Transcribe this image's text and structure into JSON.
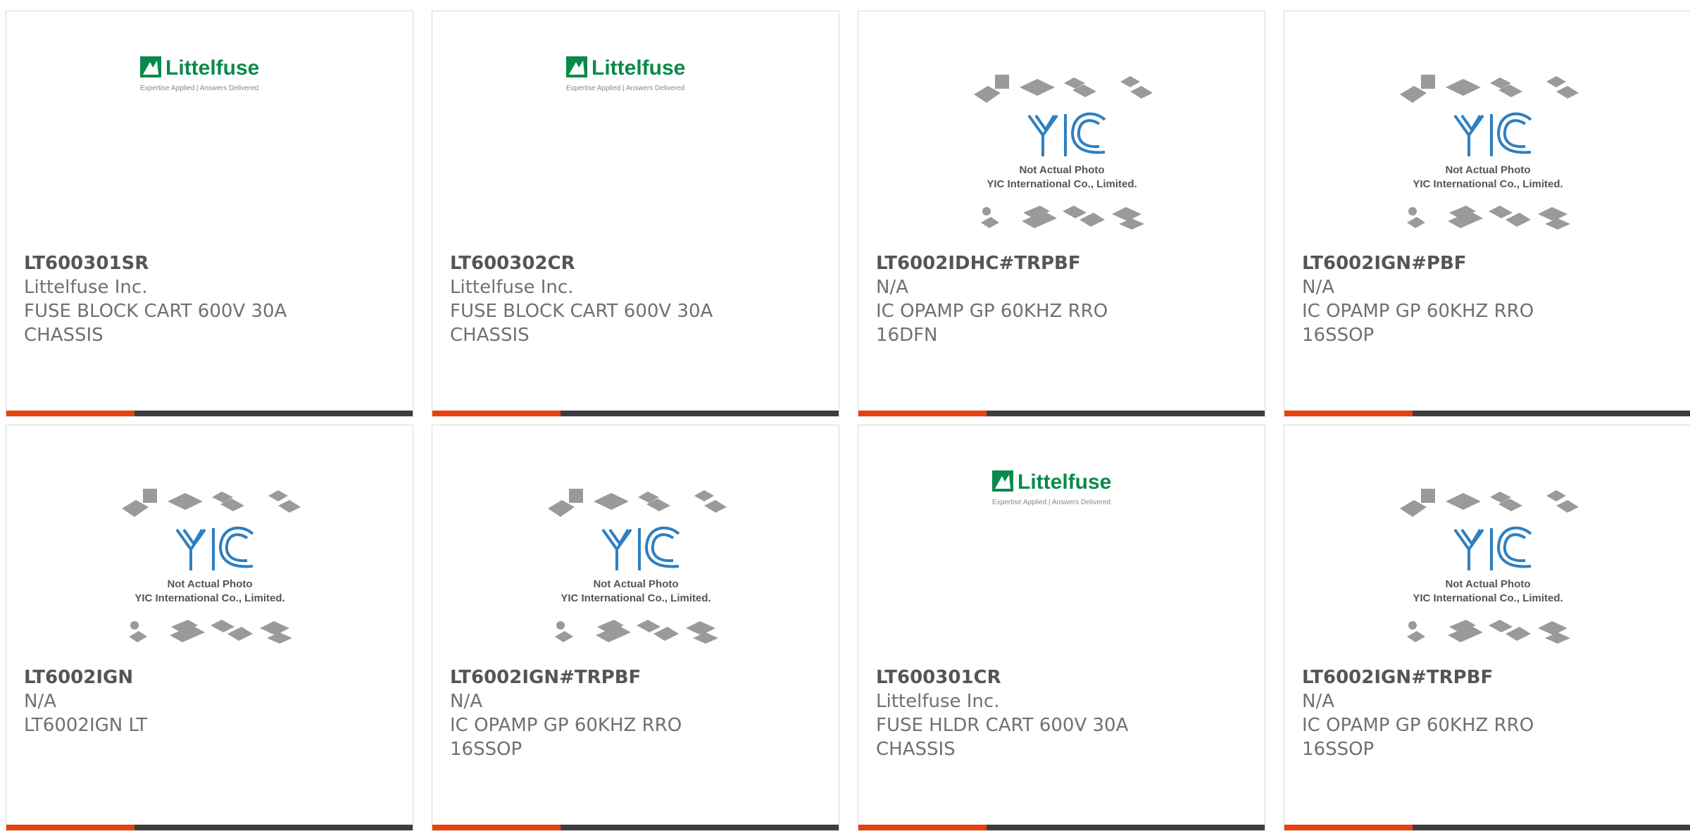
{
  "colors": {
    "accent": "#e8410a",
    "bar_dark": "#3d3d3d",
    "littelfuse_green": "#0a8a4a",
    "yic_blue": "#2d7fc1"
  },
  "logos": {
    "littelfuse": {
      "name": "Littelfuse",
      "tagline": "Expertise Applied | Answers Delivered"
    },
    "yic": {
      "mark": "YIC",
      "line1": "Not Actual Photo",
      "line2": "YIC International Co., Limited."
    }
  },
  "products": [
    {
      "image": "littelfuse",
      "part": "LT600301SR",
      "manufacturer": "Littelfuse Inc.",
      "description": "FUSE BLOCK CART 600V 30A CHASSIS"
    },
    {
      "image": "littelfuse",
      "part": "LT600302CR",
      "manufacturer": "Littelfuse Inc.",
      "description": "FUSE BLOCK CART 600V 30A CHASSIS"
    },
    {
      "image": "yic",
      "part": "LT6002IDHC#TRPBF",
      "manufacturer": "N/A",
      "description": "IC OPAMP GP 60KHZ RRO 16DFN"
    },
    {
      "image": "yic",
      "part": "LT6002IGN#PBF",
      "manufacturer": "N/A",
      "description": "IC OPAMP GP 60KHZ RRO 16SSOP"
    },
    {
      "image": "yic",
      "part": "LT6002IGN",
      "manufacturer": "N/A",
      "description": "LT6002IGN LT"
    },
    {
      "image": "yic",
      "part": "LT6002IGN#TRPBF",
      "manufacturer": "N/A",
      "description": "IC OPAMP GP 60KHZ RRO 16SSOP"
    },
    {
      "image": "littelfuse",
      "part": "LT600301CR",
      "manufacturer": "Littelfuse Inc.",
      "description": "FUSE HLDR CART 600V 30A CHASSIS"
    },
    {
      "image": "yic",
      "part": "LT6002IGN#TRPBF",
      "manufacturer": "N/A",
      "description": "IC OPAMP GP 60KHZ RRO 16SSOP"
    }
  ]
}
